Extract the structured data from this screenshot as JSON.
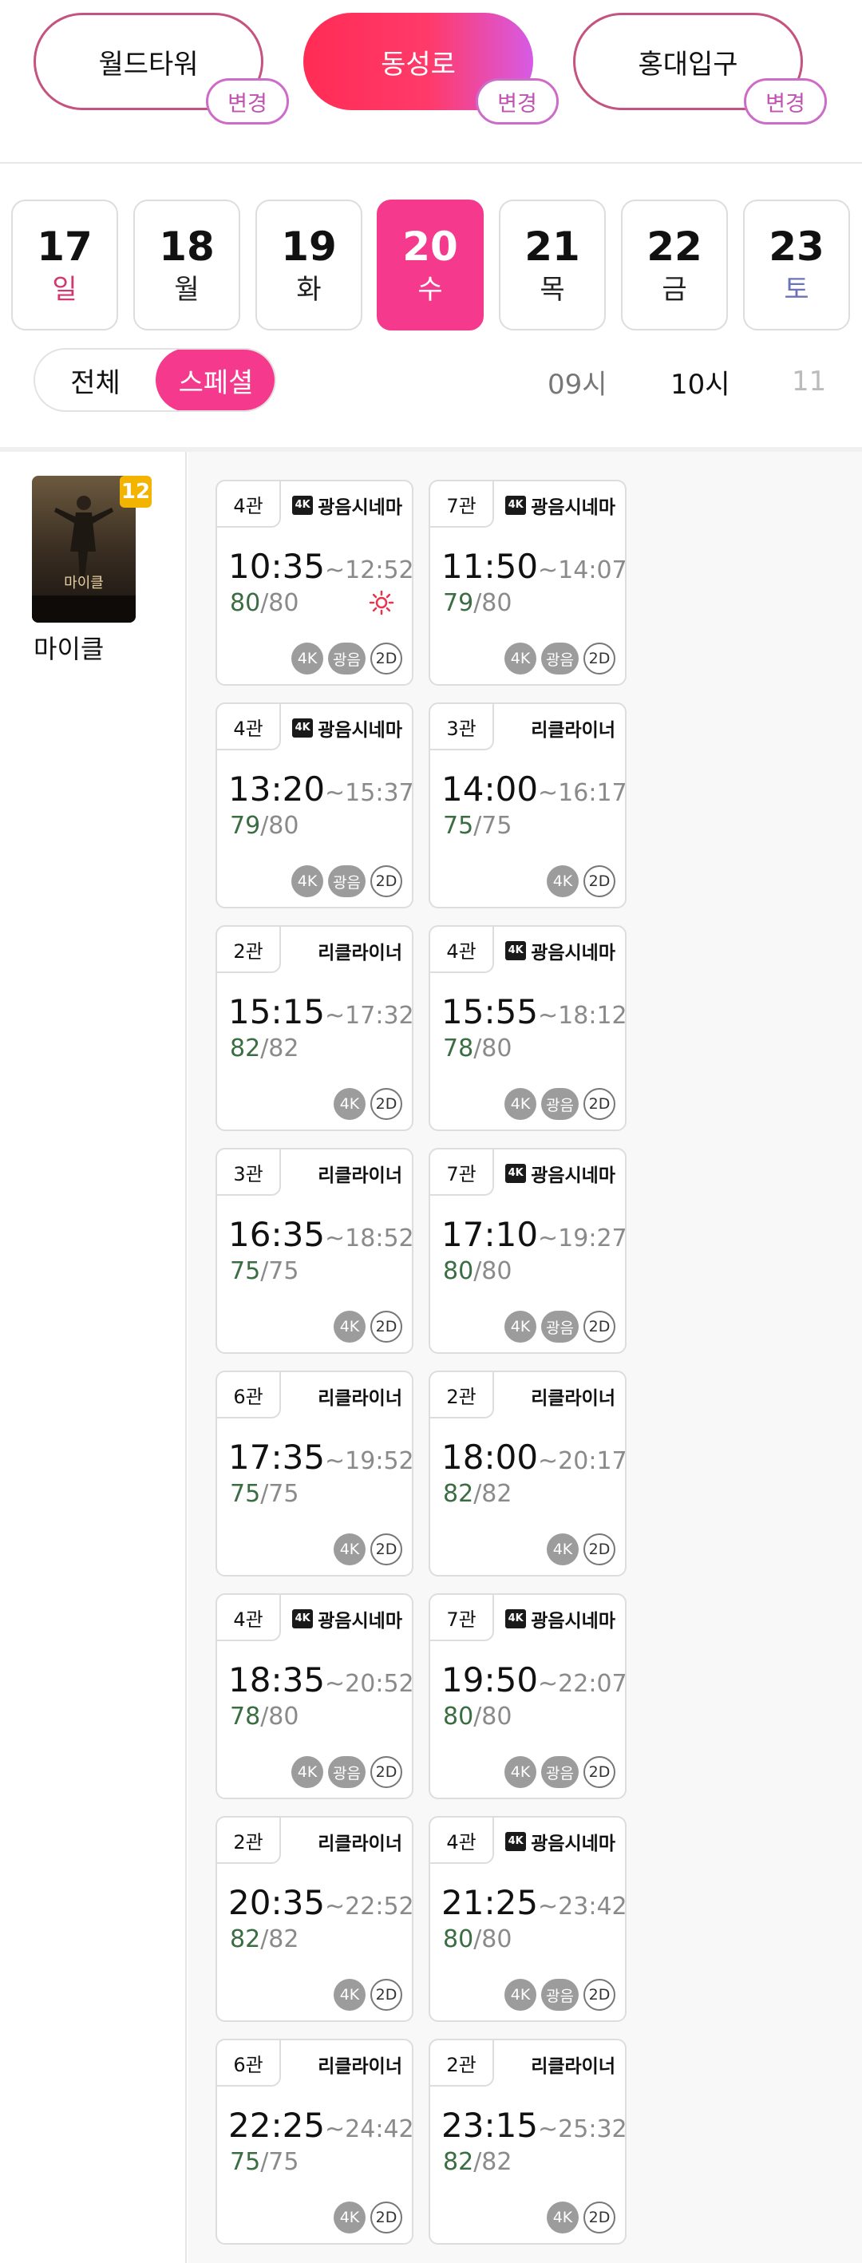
{
  "theaters": [
    {
      "name": "월드타워",
      "change": "변경",
      "active": false
    },
    {
      "name": "동성로",
      "change": "변경",
      "active": true
    },
    {
      "name": "홍대입구",
      "change": "변경",
      "active": false
    }
  ],
  "dates": [
    {
      "day": "17",
      "dow": "일",
      "dow_color": "#d0386f",
      "active": false
    },
    {
      "day": "18",
      "dow": "월",
      "dow_color": "#222222",
      "active": false
    },
    {
      "day": "19",
      "dow": "화",
      "dow_color": "#222222",
      "active": false
    },
    {
      "day": "20",
      "dow": "수",
      "dow_color": "#ffffff",
      "active": true
    },
    {
      "day": "21",
      "dow": "목",
      "dow_color": "#222222",
      "active": false
    },
    {
      "day": "22",
      "dow": "금",
      "dow_color": "#222222",
      "active": false
    },
    {
      "day": "23",
      "dow": "토",
      "dow_color": "#6b73b8",
      "active": false
    }
  ],
  "filter": {
    "all": "전체",
    "special": "스페셜",
    "active": "special"
  },
  "hours": [
    {
      "label": "09시",
      "color": "#777777"
    },
    {
      "label": "10시",
      "color": "#111111"
    },
    {
      "label": "11",
      "color": "#bbbbbb"
    }
  ],
  "movie": {
    "title": "마이클",
    "rating": "12",
    "poster_text": "마이클"
  },
  "colors": {
    "accent": "#f5398c",
    "seat_available": "#3b6d42"
  },
  "showtimes": [
    {
      "screen": "4관",
      "brand": "광음시네마",
      "brand_icon": true,
      "start": "10:35",
      "end": "~12:52",
      "available": "80",
      "total": "/80",
      "morning": true,
      "badges": [
        "4K",
        "광음",
        "2D"
      ]
    },
    {
      "screen": "7관",
      "brand": "광음시네마",
      "brand_icon": true,
      "start": "11:50",
      "end": "~14:07",
      "available": "79",
      "total": "/80",
      "morning": false,
      "badges": [
        "4K",
        "광음",
        "2D"
      ]
    },
    {
      "screen": "4관",
      "brand": "광음시네마",
      "brand_icon": true,
      "start": "13:20",
      "end": "~15:37",
      "available": "79",
      "total": "/80",
      "morning": false,
      "badges": [
        "4K",
        "광음",
        "2D"
      ]
    },
    {
      "screen": "3관",
      "brand": "리클라이너",
      "brand_icon": false,
      "start": "14:00",
      "end": "~16:17",
      "available": "75",
      "total": "/75",
      "morning": false,
      "badges": [
        "4K",
        "2D"
      ]
    },
    {
      "screen": "2관",
      "brand": "리클라이너",
      "brand_icon": false,
      "start": "15:15",
      "end": "~17:32",
      "available": "82",
      "total": "/82",
      "morning": false,
      "badges": [
        "4K",
        "2D"
      ]
    },
    {
      "screen": "4관",
      "brand": "광음시네마",
      "brand_icon": true,
      "start": "15:55",
      "end": "~18:12",
      "available": "78",
      "total": "/80",
      "morning": false,
      "badges": [
        "4K",
        "광음",
        "2D"
      ]
    },
    {
      "screen": "3관",
      "brand": "리클라이너",
      "brand_icon": false,
      "start": "16:35",
      "end": "~18:52",
      "available": "75",
      "total": "/75",
      "morning": false,
      "badges": [
        "4K",
        "2D"
      ]
    },
    {
      "screen": "7관",
      "brand": "광음시네마",
      "brand_icon": true,
      "start": "17:10",
      "end": "~19:27",
      "available": "80",
      "total": "/80",
      "morning": false,
      "badges": [
        "4K",
        "광음",
        "2D"
      ]
    },
    {
      "screen": "6관",
      "brand": "리클라이너",
      "brand_icon": false,
      "start": "17:35",
      "end": "~19:52",
      "available": "75",
      "total": "/75",
      "morning": false,
      "badges": [
        "4K",
        "2D"
      ]
    },
    {
      "screen": "2관",
      "brand": "리클라이너",
      "brand_icon": false,
      "start": "18:00",
      "end": "~20:17",
      "available": "82",
      "total": "/82",
      "morning": false,
      "badges": [
        "4K",
        "2D"
      ]
    },
    {
      "screen": "4관",
      "brand": "광음시네마",
      "brand_icon": true,
      "start": "18:35",
      "end": "~20:52",
      "available": "78",
      "total": "/80",
      "morning": false,
      "badges": [
        "4K",
        "광음",
        "2D"
      ]
    },
    {
      "screen": "7관",
      "brand": "광음시네마",
      "brand_icon": true,
      "start": "19:50",
      "end": "~22:07",
      "available": "80",
      "total": "/80",
      "morning": false,
      "badges": [
        "4K",
        "광음",
        "2D"
      ]
    },
    {
      "screen": "2관",
      "brand": "리클라이너",
      "brand_icon": false,
      "start": "20:35",
      "end": "~22:52",
      "available": "82",
      "total": "/82",
      "morning": false,
      "badges": [
        "4K",
        "2D"
      ]
    },
    {
      "screen": "4관",
      "brand": "광음시네마",
      "brand_icon": true,
      "start": "21:25",
      "end": "~23:42",
      "available": "80",
      "total": "/80",
      "morning": false,
      "badges": [
        "4K",
        "광음",
        "2D"
      ]
    },
    {
      "screen": "6관",
      "brand": "리클라이너",
      "brand_icon": false,
      "start": "22:25",
      "end": "~24:42",
      "available": "75",
      "total": "/75",
      "morning": false,
      "badges": [
        "4K",
        "2D"
      ]
    },
    {
      "screen": "2관",
      "brand": "리클라이너",
      "brand_icon": false,
      "start": "23:15",
      "end": "~25:32",
      "available": "82",
      "total": "/82",
      "morning": false,
      "badges": [
        "4K",
        "2D"
      ]
    }
  ]
}
